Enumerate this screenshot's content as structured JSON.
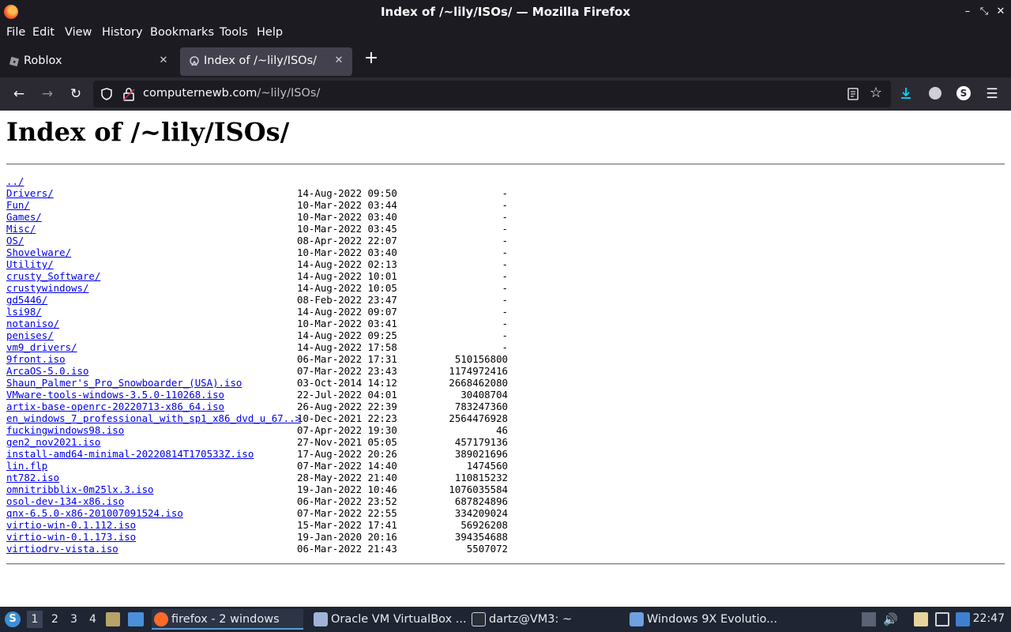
{
  "window": {
    "title": "Index of /~lily/ISOs/ — Mozilla Firefox"
  },
  "menu": [
    "File",
    "Edit",
    "View",
    "History",
    "Bookmarks",
    "Tools",
    "Help"
  ],
  "tabs": [
    {
      "label": "Roblox",
      "active": false
    },
    {
      "label": "Index of /~lily/ISOs/",
      "active": true
    }
  ],
  "url": {
    "host": "computernewb.com",
    "path": "/~lily/ISOs/"
  },
  "page": {
    "heading": "Index of /~lily/ISOs/",
    "entries": [
      {
        "name": "../",
        "date": "",
        "size": ""
      },
      {
        "name": "Drivers/",
        "date": "14-Aug-2022 09:50",
        "size": "-"
      },
      {
        "name": "Fun/",
        "date": "10-Mar-2022 03:44",
        "size": "-"
      },
      {
        "name": "Games/",
        "date": "10-Mar-2022 03:40",
        "size": "-"
      },
      {
        "name": "Misc/",
        "date": "10-Mar-2022 03:45",
        "size": "-"
      },
      {
        "name": "OS/",
        "date": "08-Apr-2022 22:07",
        "size": "-"
      },
      {
        "name": "Shovelware/",
        "date": "10-Mar-2022 03:40",
        "size": "-"
      },
      {
        "name": "Utility/",
        "date": "14-Aug-2022 02:13",
        "size": "-"
      },
      {
        "name": "crusty_Software/",
        "date": "14-Aug-2022 10:01",
        "size": "-"
      },
      {
        "name": "crustywindows/",
        "date": "14-Aug-2022 10:05",
        "size": "-"
      },
      {
        "name": "gd5446/",
        "date": "08-Feb-2022 23:47",
        "size": "-"
      },
      {
        "name": "lsi98/",
        "date": "14-Aug-2022 09:07",
        "size": "-"
      },
      {
        "name": "notaniso/",
        "date": "10-Mar-2022 03:41",
        "size": "-"
      },
      {
        "name": "penises/",
        "date": "14-Aug-2022 09:25",
        "size": "-"
      },
      {
        "name": "vm9_drivers/",
        "date": "14-Aug-2022 17:58",
        "size": "-"
      },
      {
        "name": "9front.iso",
        "date": "06-Mar-2022 17:31",
        "size": "510156800"
      },
      {
        "name": "ArcaOS-5.0.iso",
        "date": "07-Mar-2022 23:43",
        "size": "1174972416"
      },
      {
        "name": "Shaun_Palmer's_Pro_Snowboarder_(USA).iso",
        "date": "03-Oct-2014 14:12",
        "size": "2668462080"
      },
      {
        "name": "VMware-tools-windows-3.5.0-110268.iso",
        "date": "22-Jul-2022 04:01",
        "size": "30408704"
      },
      {
        "name": "artix-base-openrc-20220713-x86_64.iso",
        "date": "26-Aug-2022 22:39",
        "size": "783247360"
      },
      {
        "name": "en_windows_7_professional_with_sp1_x86_dvd_u_67..>",
        "date": "10-Dec-2021 22:23",
        "size": "2564476928"
      },
      {
        "name": "fuckingwindows98.iso",
        "date": "07-Apr-2022 19:30",
        "size": "46"
      },
      {
        "name": "gen2_nov2021.iso",
        "date": "27-Nov-2021 05:05",
        "size": "457179136"
      },
      {
        "name": "install-amd64-minimal-20220814T170533Z.iso",
        "date": "17-Aug-2022 20:26",
        "size": "389021696"
      },
      {
        "name": "lin.flp",
        "date": "07-Mar-2022 14:40",
        "size": "1474560"
      },
      {
        "name": "nt782.iso",
        "date": "28-May-2022 21:40",
        "size": "110815232"
      },
      {
        "name": "omnitribblix-0m25lx.3.iso",
        "date": "19-Jan-2022 10:46",
        "size": "1076035584"
      },
      {
        "name": "osol-dev-134-x86.iso",
        "date": "06-Mar-2022 23:52",
        "size": "687824896"
      },
      {
        "name": "qnx-6.5.0-x86-201007091524.iso",
        "date": "07-Mar-2022 22:55",
        "size": "334209024"
      },
      {
        "name": "virtio-win-0.1.112.iso",
        "date": "15-Mar-2022 17:41",
        "size": "56926208"
      },
      {
        "name": "virtio-win-0.1.173.iso",
        "date": "19-Jan-2020 20:16",
        "size": "394354688"
      },
      {
        "name": "virtiodrv-vista.iso",
        "date": "06-Mar-2022 21:43",
        "size": "5507072"
      }
    ]
  },
  "taskbar": {
    "workspaces": [
      "1",
      "2",
      "3",
      "4"
    ],
    "current_workspace": "1",
    "tasks": [
      {
        "label": "firefox - 2 windows",
        "active": true
      },
      {
        "label": "Oracle VM VirtualBox ...",
        "active": false
      },
      {
        "label": "dartz@VM3: ~",
        "active": false
      },
      {
        "label": "Windows 9X Evolutio...",
        "active": false
      }
    ],
    "clock": "22:47"
  },
  "icons": {
    "titlebar": [
      "firefox-icon",
      "minimize-icon",
      "maximize-icon",
      "close-icon"
    ],
    "navbar": [
      "back-icon",
      "forward-icon",
      "reload-icon",
      "shield-icon",
      "lock-icon",
      "reader-view-icon",
      "bookmark-star-icon",
      "downloads-icon",
      "account-icon",
      "extension-icon",
      "menu-icon"
    ]
  },
  "colors": {
    "chrome_dark": "#1c1b22",
    "toolbar": "#2b2a33",
    "link": "#0000ee",
    "download_accent": "#00ddff",
    "taskbar": "#1f2532"
  }
}
